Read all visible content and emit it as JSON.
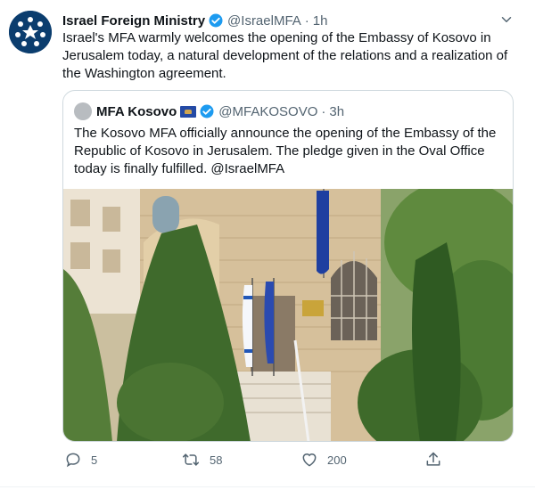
{
  "tweet": {
    "author_name": "Israel Foreign Ministry",
    "author_handle": "@IsraelMFA",
    "time": "1h",
    "dot": "·",
    "text": "Israel's MFA warmly welcomes the opening of the Embassy of Kosovo in Jerusalem today, a natural development of the relations and a realization of the Washington agreement.",
    "verified": true
  },
  "quoted": {
    "author_name": "MFA Kosovo",
    "author_handle": "@MFAKOSOVO",
    "time": "3h",
    "dot": "·",
    "text": "The Kosovo MFA officially announce the opening of the Embassy of the Republic of Kosovo in Jerusalem. The pledge given in the Oval Office today is finally fulfilled. @IsraelMFA",
    "verified": true,
    "flag_icon": "kosovo-flag-icon"
  },
  "actions": {
    "replies": "5",
    "retweets": "58",
    "likes": "200"
  },
  "colors": {
    "accent": "#1d9bf0",
    "secondary_text": "#536471",
    "border": "#cfd9de"
  }
}
